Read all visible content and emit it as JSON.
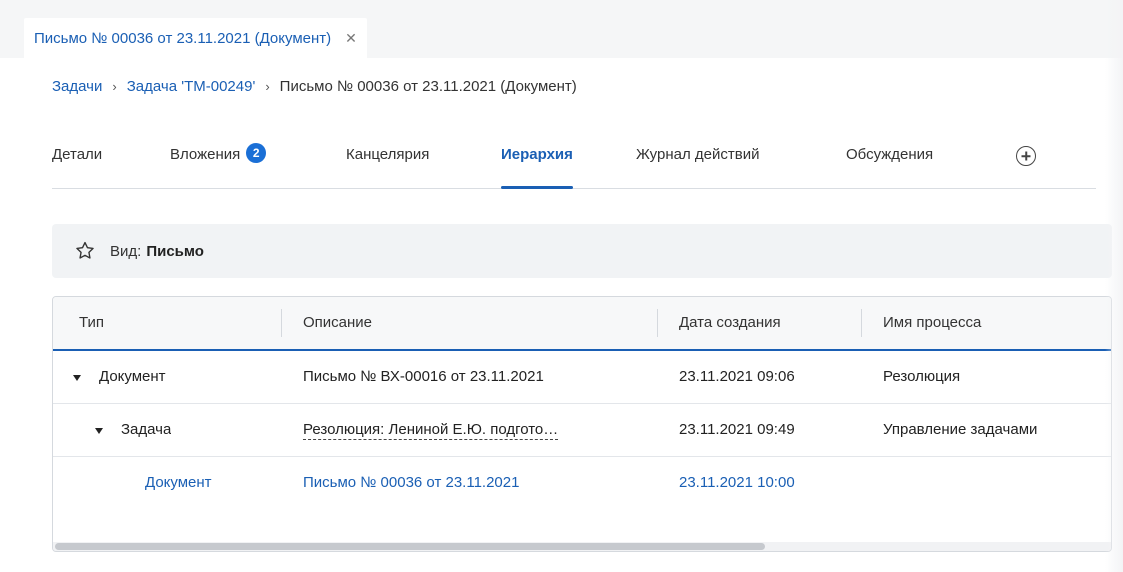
{
  "window_tab": {
    "title": "Письмо № 00036 от 23.11.2021 (Документ)",
    "close_glyph": "✕"
  },
  "breadcrumb": {
    "items": [
      "Задачи",
      "Задача 'ТМ-00249'",
      "Письмо № 00036 от 23.11.2021 (Документ)"
    ],
    "separator": "›"
  },
  "tabs": [
    {
      "label": "Детали"
    },
    {
      "label": "Вложения",
      "badge": "2"
    },
    {
      "label": "Канцелярия"
    },
    {
      "label": "Иерархия",
      "active": true
    },
    {
      "label": "Журнал действий"
    },
    {
      "label": "Обсуждения"
    }
  ],
  "kind": {
    "label": "Вид:",
    "value": "Письмо"
  },
  "table": {
    "columns": [
      "Тип",
      "Описание",
      "Дата создания",
      "Имя процесса"
    ],
    "rows": [
      {
        "type": "Документ",
        "description": "Письмо № ВХ-00016 от 23.11.2021",
        "created": "23.11.2021 09:06",
        "process": "Резолюция"
      },
      {
        "type": "Задача",
        "description": "Резолюция: Лениной Е.Ю. подгото…",
        "created": "23.11.2021 09:49",
        "process": "Управление задачами"
      },
      {
        "type": "Документ",
        "description": "Письмо № 00036 от 23.11.2021",
        "created": "23.11.2021 10:00",
        "process": ""
      }
    ]
  },
  "colors": {
    "accent": "#1a5fb4",
    "badge": "#1a6fd6"
  },
  "icons": {
    "star": "star-outline-icon",
    "add_tab": "plus-circle-icon",
    "caret": "caret-down-icon",
    "close": "close-icon",
    "chevron": "chevron-right-icon"
  }
}
